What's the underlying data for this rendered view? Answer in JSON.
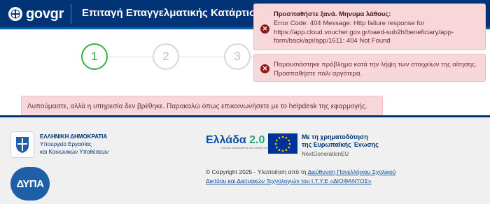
{
  "header": {
    "logo_text": "govgr",
    "title": "Επιταγή Επαγγελματικής Κατάρτιση"
  },
  "stepper": {
    "steps": [
      "1",
      "2",
      "3"
    ],
    "active_index": 0
  },
  "inline_error": {
    "text": "Λυπούμαστε, αλλά η υπηρεσία δεν βρέθηκε. Παρακαλώ όπως επικοινωνήσετε με το helpdesk της εφαρμογής."
  },
  "toasts": [
    {
      "icon": "error-x-icon",
      "title": "Προσπαθήστε ξανά. Μηνυμα λάθους:",
      "text": "Error Code: 404 Message: Http failure response for https://app.cloud.voucher.gov.gr/oaed-sub2h/beneficiary/app-form/back/api/app/1611: 404 Not Found"
    },
    {
      "icon": "error-x-icon",
      "title": "",
      "text": "Παρουσιάστηκε πρόβλημα κατά την λήψη των στοιχείων της αίτησης. Προσπαθήστε πάλι αργότερα."
    }
  ],
  "footer": {
    "ministry": {
      "line1": "ΕΛΛΗΝΙΚΗ ΔΗΜΟΚΡΑΤΙΑ",
      "line2": "Υπουργείο Εργασίας",
      "line3": "και Κοινωνικών Υποθέσεων"
    },
    "dypa": "ΔΥΠΑ",
    "ellada": {
      "main": "Ελλάδα",
      "version": "2.0",
      "sub": "ΣΧΕΔΙΟ ΑΝΑΚΑΜΨΗΣ ΚΑΙ ΑΝΘΕΚΤΙΚΟΤΗΤΑΣ"
    },
    "eu": {
      "line1": "Με τη χρηματοδότηση",
      "line2": "της Ευρωπαϊκής Ένωσης",
      "line3": "NextGenerationEU"
    },
    "copyright": {
      "prefix": "© Copyright 2025 - Υλοποίηση από τη ",
      "link": "Διεύθυνση Πανελλήνιου Σχολικού Δικτύου και Δικτυακών Τεχνολογιών του Ι.Τ.Υ.Ε «ΔΙΟΦΑΝΤΟΣ»"
    }
  },
  "colors": {
    "header_bg": "#003476",
    "active_step": "#2fb34a",
    "error_bg": "#f8d7da",
    "error_icon": "#8a1c1c",
    "footer_bg": "#f0f0f0"
  }
}
